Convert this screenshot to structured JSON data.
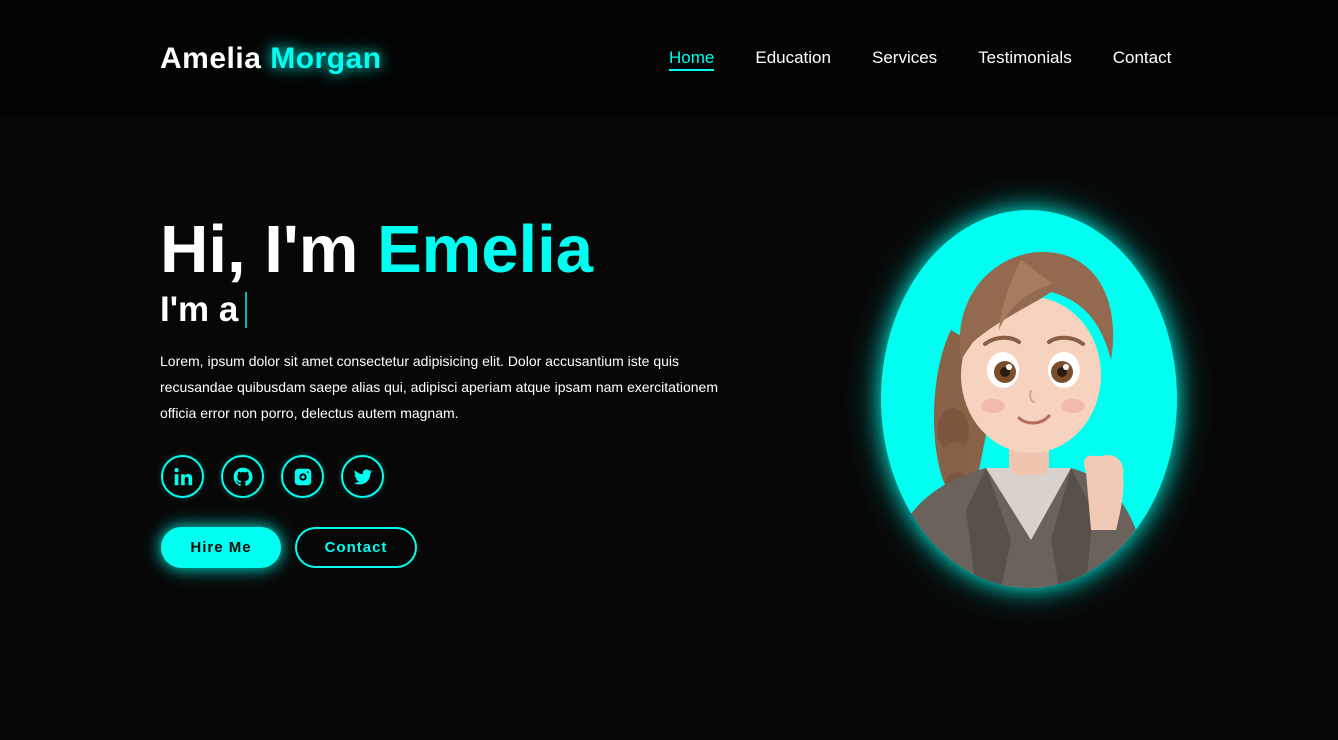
{
  "brand": {
    "first": "Amelia",
    "last": "Morgan",
    "accent": "#00fff0"
  },
  "nav": {
    "items": [
      {
        "label": "Home",
        "active": true
      },
      {
        "label": "Education",
        "active": false
      },
      {
        "label": "Services",
        "active": false
      },
      {
        "label": "Testimonials",
        "active": false
      },
      {
        "label": "Contact",
        "active": false
      }
    ]
  },
  "hero": {
    "greeting": "Hi, I'm",
    "name": "Emelia",
    "subtitle": "I'm a",
    "description": "Lorem, ipsum dolor sit amet consectetur adipisicing elit. Dolor accusantium iste quis recusandae quibusdam saepe alias qui, adipisci aperiam atque ipsam nam exercitationem officia error non porro, delectus autem magnam."
  },
  "socials": [
    {
      "icon": "linkedin-icon"
    },
    {
      "icon": "github-icon"
    },
    {
      "icon": "instagram-icon"
    },
    {
      "icon": "twitter-icon"
    }
  ],
  "buttons": {
    "hire": "Hire Me",
    "contact": "Contact"
  },
  "portrait": {
    "icon": "avatar-illustration",
    "background": "#00fff0"
  }
}
